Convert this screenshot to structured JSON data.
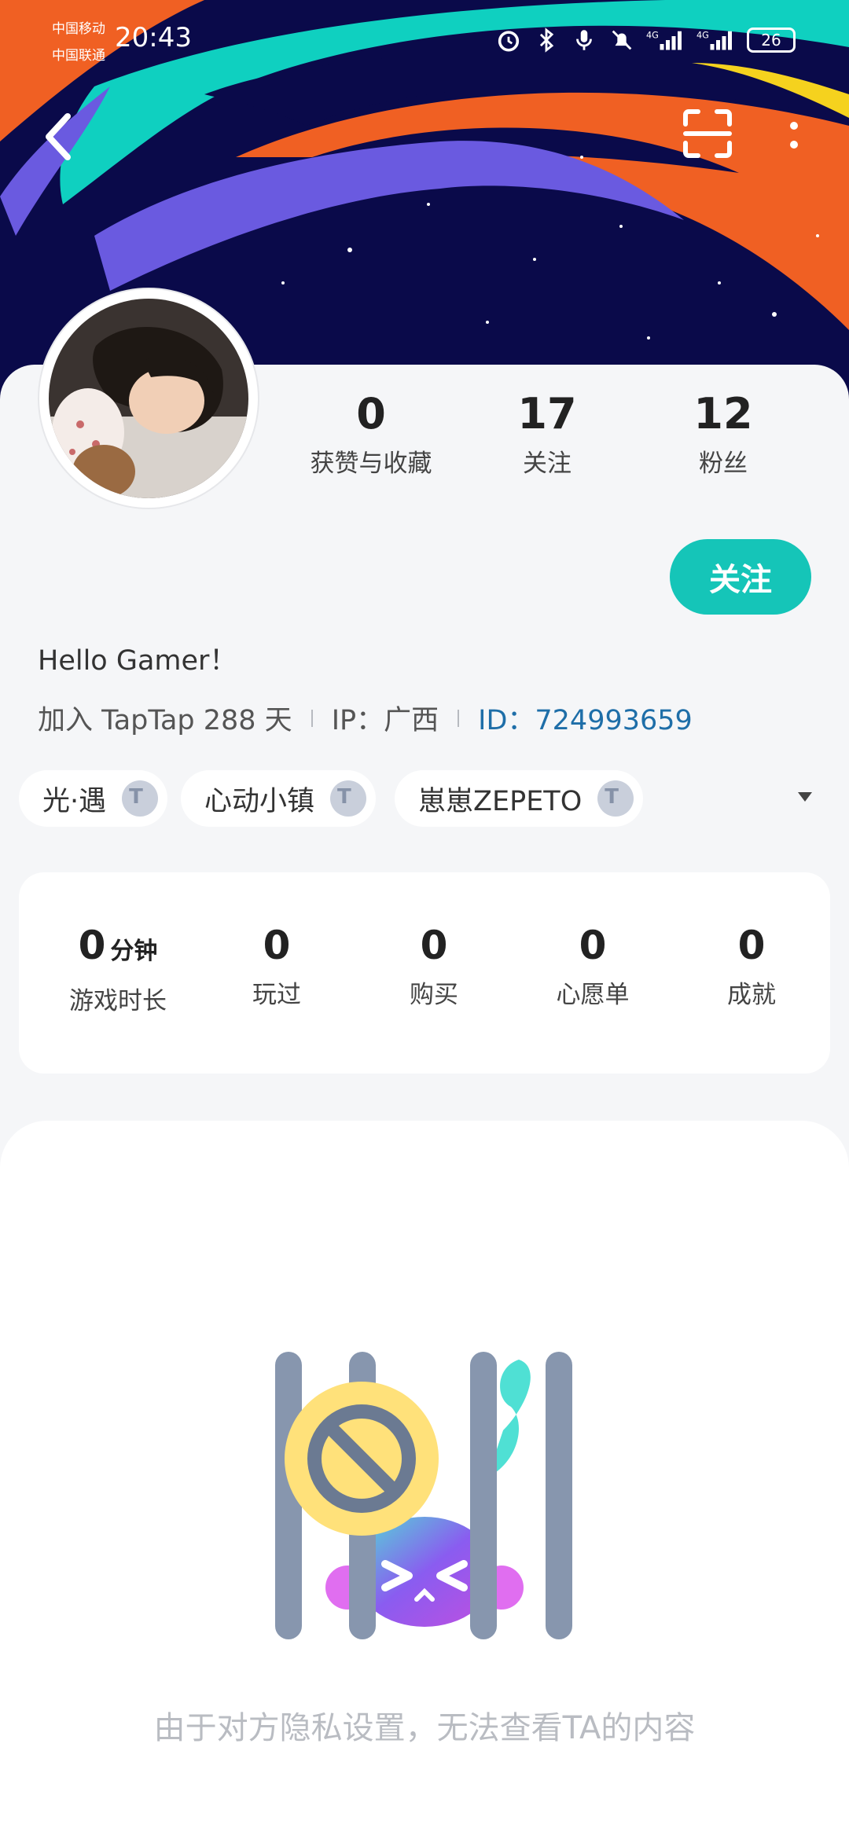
{
  "status_bar": {
    "carrier_1": "中国移动",
    "carrier_2": "中国联通",
    "time": "20:43",
    "network_1": "4G",
    "network_2": "4G",
    "battery": "26"
  },
  "profile": {
    "stats": [
      {
        "value": "0",
        "label": "获赞与收藏"
      },
      {
        "value": "17",
        "label": "关注"
      },
      {
        "value": "12",
        "label": "粉丝"
      }
    ],
    "follow_label": "关注",
    "bio": "Hello Gamer！",
    "join_text": "加入 TapTap 288 天",
    "ip_text": "IP：广西",
    "id_text": "ID：724993659"
  },
  "tags": [
    {
      "name": "光·遇",
      "badge": "T"
    },
    {
      "name": "心动小镇",
      "badge": "T"
    },
    {
      "name": "崽崽ZEPETO",
      "badge": "T"
    }
  ],
  "game_stats": {
    "playtime_value": "0",
    "playtime_unit": "分钟",
    "playtime_label": "游戏时长",
    "played_value": "0",
    "played_label": "玩过",
    "bought_value": "0",
    "bought_label": "购买",
    "wishlist_value": "0",
    "wishlist_label": "心愿单",
    "achievements_value": "0",
    "achievements_label": "成就"
  },
  "privacy_message": "由于对方隐私设置，无法查看TA的内容",
  "colors": {
    "accent": "#15c5b8",
    "banner_bg": "#0a0a4a",
    "banner_orange": "#f06023",
    "banner_purple": "#6a5ae0",
    "banner_teal": "#0fd0c0",
    "banner_yellow": "#f5d21e",
    "id_link": "#1e6ea8"
  }
}
